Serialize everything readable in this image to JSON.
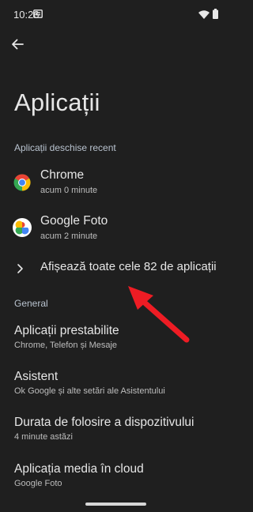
{
  "status_bar": {
    "time": "10:26",
    "icons": [
      "sim-card-icon",
      "wifi-icon",
      "battery-icon"
    ]
  },
  "header": {
    "back_icon": "arrow-left-icon",
    "title": "Aplicații"
  },
  "recent": {
    "heading": "Aplicații deschise recent",
    "apps": [
      {
        "name": "Chrome",
        "sub": "acum 0 minute",
        "icon": "chrome-icon"
      },
      {
        "name": "Google Foto",
        "sub": "acum 2 minute",
        "icon": "google-photos-icon"
      }
    ],
    "show_all": "Afișează toate cele 82 de aplicații"
  },
  "general": {
    "heading": "General",
    "items": [
      {
        "title": "Aplicații prestabilite",
        "sub": "Chrome, Telefon și Mesaje"
      },
      {
        "title": "Asistent",
        "sub": "Ok Google și alte setări ale Asistentului"
      },
      {
        "title": "Durata de folosire a dispozitivului",
        "sub": "4 minute astăzi"
      },
      {
        "title": "Aplicația media în cloud",
        "sub": "Google Foto"
      }
    ]
  },
  "colors": {
    "background": "#1f1f1f",
    "text": "#e6e6e6",
    "section": "#b9c3cf",
    "annotation_arrow": "#ee1c24"
  }
}
